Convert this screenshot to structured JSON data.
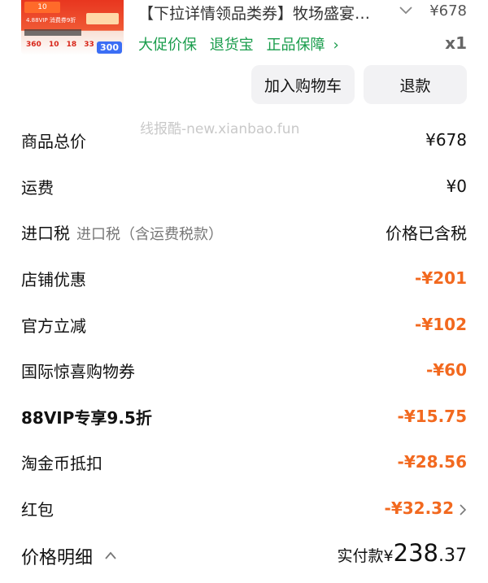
{
  "product": {
    "thumbnail": {
      "badge": "10",
      "promo_text": "4.88VIP 消费券9折",
      "day_labels": [
        "360",
        "10",
        "18",
        "33"
      ],
      "tag": "300"
    },
    "title": "【下拉详情领品类券】牧场盛宴…",
    "price": "¥678",
    "quantity": "x1",
    "badges": [
      "大促价保",
      "退货宝",
      "正品保障"
    ],
    "badge_chevron": "›"
  },
  "actions": {
    "add_to_cart": "加入购物车",
    "refund": "退款"
  },
  "watermark": "线报酷-new.xianbao.fun",
  "rows": [
    {
      "label": "商品总价",
      "value": "¥678"
    },
    {
      "label": "运费",
      "value": "¥0"
    },
    {
      "label": "进口税",
      "sub": "进口税（含运费税款）",
      "value": "价格已含税"
    },
    {
      "label": "店铺优惠",
      "value": "-¥201"
    },
    {
      "label": "官方立减",
      "value": "-¥102"
    },
    {
      "label": "国际惊喜购物券",
      "value": "-¥60"
    },
    {
      "label": "88VIP专享9.5折",
      "value": "-¥15.75"
    },
    {
      "label": "淘金币抵扣",
      "value": "-¥28.56"
    },
    {
      "label": "红包",
      "value": "-¥32.32"
    }
  ],
  "footer": {
    "detail_label": "价格明细",
    "paid_label": "实付款",
    "currency": "¥",
    "amount_int": "238",
    "amount_dec": ".37"
  },
  "colors": {
    "discount": "#f2691f",
    "guarantee": "#1a9d4c"
  }
}
